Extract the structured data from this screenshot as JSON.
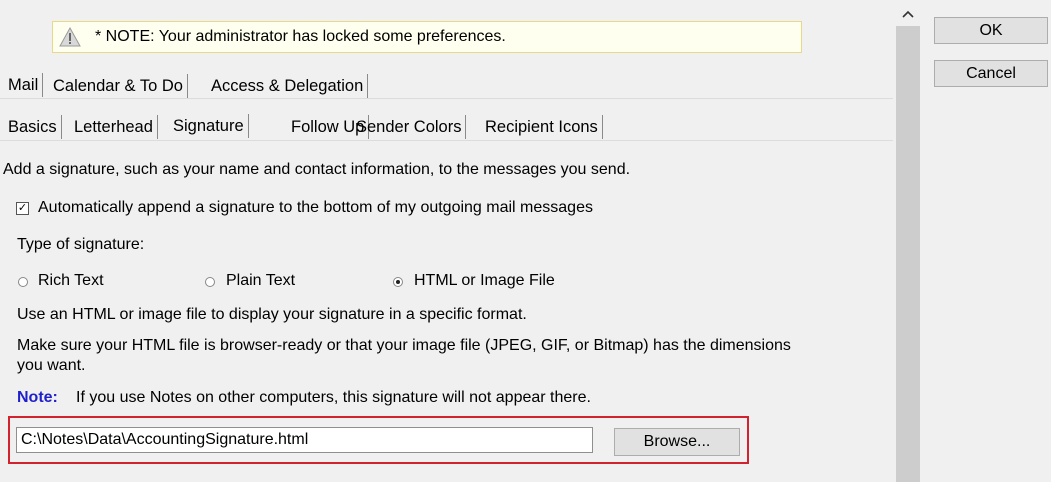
{
  "note_banner": {
    "icon": "warning-icon",
    "text": "* NOTE: Your administrator has locked some preferences."
  },
  "main_tabs": [
    {
      "label": "Mail",
      "active": true
    },
    {
      "label": "Calendar & To Do",
      "active": false
    },
    {
      "label": "Access & Delegation",
      "active": false
    }
  ],
  "sub_tabs": [
    {
      "label": "Basics",
      "active": false
    },
    {
      "label": "Letterhead",
      "active": false
    },
    {
      "label": "Signature",
      "active": true
    },
    {
      "label": "Follow Up",
      "active": false
    },
    {
      "label": "Sender Colors",
      "active": false
    },
    {
      "label": "Recipient Icons",
      "active": false
    }
  ],
  "signature": {
    "intro": "Add a signature, such as your name and contact information, to the messages you send.",
    "auto_append": {
      "checked": true,
      "label": "Automatically append a signature to the bottom of my outgoing mail messages"
    },
    "type_label": "Type of signature:",
    "types": [
      {
        "label": "Rich Text",
        "checked": false
      },
      {
        "label": "Plain Text",
        "checked": false
      },
      {
        "label": "HTML or Image File",
        "checked": true
      }
    ],
    "html_desc": "Use an HTML or image file to display your signature in a specific format.",
    "ready_line1": "Make sure your HTML file is browser-ready or that your image file (JPEG, GIF, or Bitmap) has the dimensions",
    "ready_line2": "you want.",
    "note_label": "Note:",
    "note_text": "If you use Notes on other computers, this signature will not appear there.",
    "file_path": "C:\\Notes\\Data\\AccountingSignature.html",
    "browse_label": "Browse..."
  },
  "dialog_buttons": {
    "ok": "OK",
    "cancel": "Cancel"
  },
  "scrollbar": {
    "up_icon": "chevron-up-icon"
  }
}
